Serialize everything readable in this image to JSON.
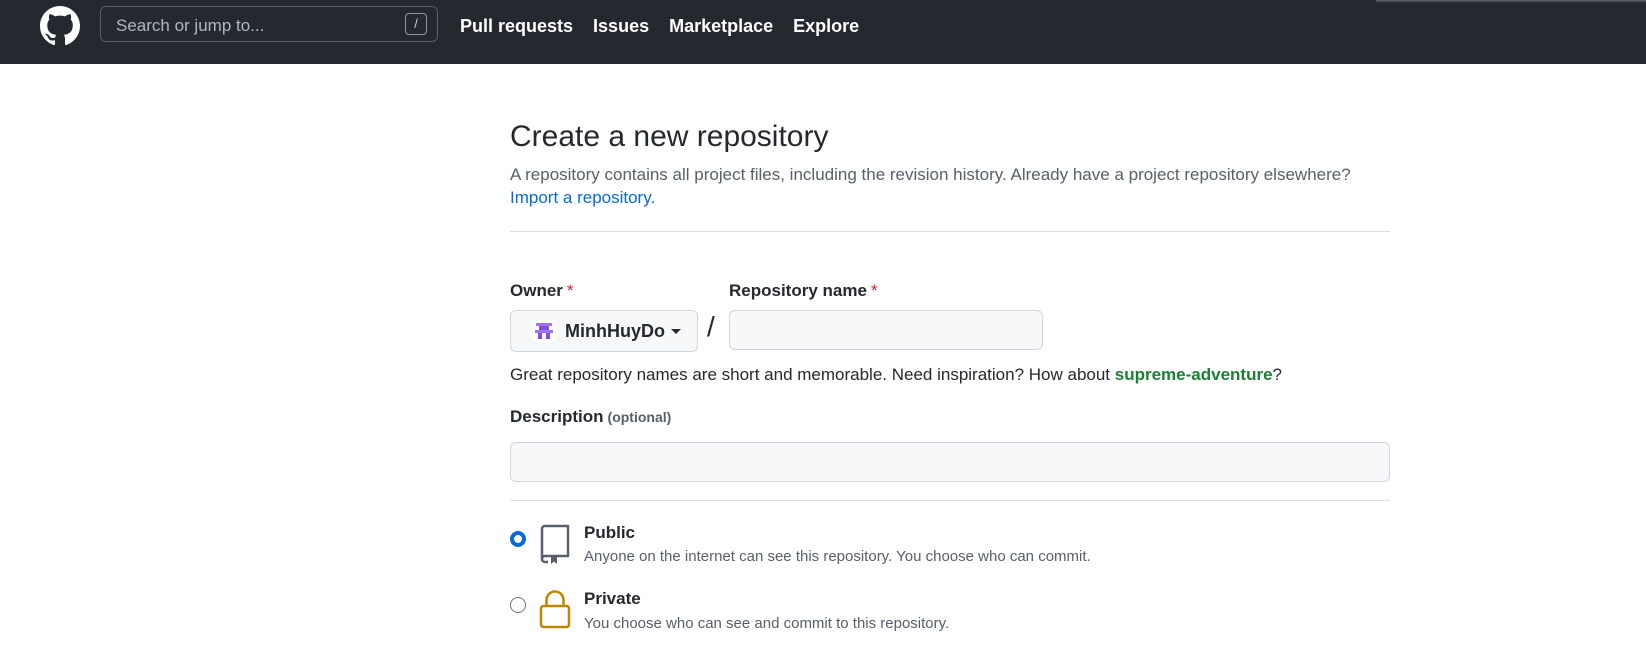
{
  "header": {
    "search_placeholder": "Search or jump to...",
    "search_shortcut": "/",
    "nav": [
      "Pull requests",
      "Issues",
      "Marketplace",
      "Explore"
    ]
  },
  "page": {
    "title": "Create a new repository",
    "subtitle": "A repository contains all project files, including the revision history. Already have a project repository elsewhere?",
    "import_link": "Import a repository."
  },
  "form": {
    "owner_label": "Owner",
    "required_mark": "*",
    "owner_value": "MinhHuyDo",
    "separator": "/",
    "repo_label": "Repository name",
    "repo_value": "",
    "hint_prefix": "Great repository names are short and memorable. Need inspiration? How about ",
    "hint_suggestion": "supreme-adventure",
    "hint_suffix": "?",
    "description_label": "Description",
    "description_optional": "(optional)",
    "description_value": ""
  },
  "visibility": {
    "selected": "public",
    "options": [
      {
        "id": "public",
        "title": "Public",
        "desc": "Anyone on the internet can see this repository. You choose who can commit.",
        "icon": "repo-icon"
      },
      {
        "id": "private",
        "title": "Private",
        "desc": "You choose who can see and commit to this repository.",
        "icon": "lock-icon"
      }
    ]
  },
  "colors": {
    "header_bg": "#24292f",
    "link": "#0969da",
    "suggestion": "#1a7f37",
    "required": "#cf222e",
    "lock": "#bf8700"
  }
}
